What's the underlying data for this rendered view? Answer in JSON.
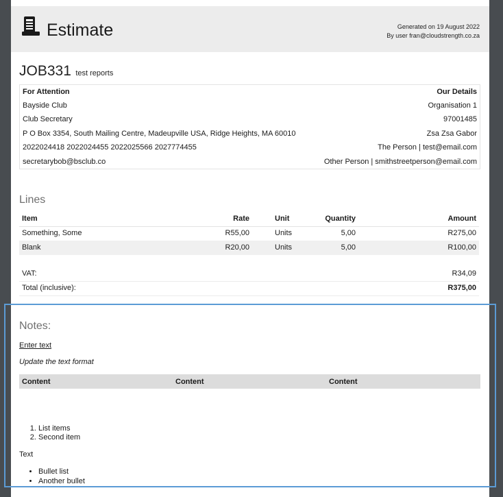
{
  "header": {
    "title": "Estimate",
    "generated": "Generated on 19 August 2022",
    "user": "By user fran@cloudstrength.co.za"
  },
  "job": {
    "number": "JOB331",
    "description": "test reports"
  },
  "contact": {
    "left_heading": "For Attention",
    "right_heading": "Our Details",
    "left": [
      "Bayside Club",
      "Club Secretary",
      "P O Box 3354, South Mailing Centre, Madeupville USA, Ridge Heights, MA 60010",
      "2022024418 2022024455 2022025566 2027774455",
      "secretarybob@bsclub.co"
    ],
    "right": [
      "Organisation 1",
      "97001485",
      "Zsa Zsa Gabor",
      "The Person | test@email.com",
      "Other Person | smithstreetperson@email.com"
    ]
  },
  "lines": {
    "title": "Lines",
    "headers": {
      "item": "Item",
      "rate": "Rate",
      "unit": "Unit",
      "quantity": "Quantity",
      "amount": "Amount"
    },
    "rows": [
      {
        "item": "Something, Some",
        "rate": "R55,00",
        "unit": "Units",
        "quantity": "5,00",
        "amount": "R275,00"
      },
      {
        "item": "Blank",
        "rate": "R20,00",
        "unit": "Units",
        "quantity": "5,00",
        "amount": "R100,00"
      }
    ],
    "vat_label": "VAT:",
    "vat_value": "R34,09",
    "total_label": "Total (inclusive):",
    "total_value": "R375,00"
  },
  "notes": {
    "title": "Notes:",
    "link_text": "Enter text",
    "italic_text": "Update the text format",
    "table_headers": [
      "Content",
      "Content",
      "Content"
    ],
    "ordered_list": [
      "List items",
      "Second item"
    ],
    "paragraph": "Text",
    "bullet_list": [
      "Bullet list",
      "Another bullet"
    ]
  },
  "colors": {
    "frame": "#5b9bd5",
    "header_bg": "#ececec",
    "backdrop": "#484c50"
  }
}
